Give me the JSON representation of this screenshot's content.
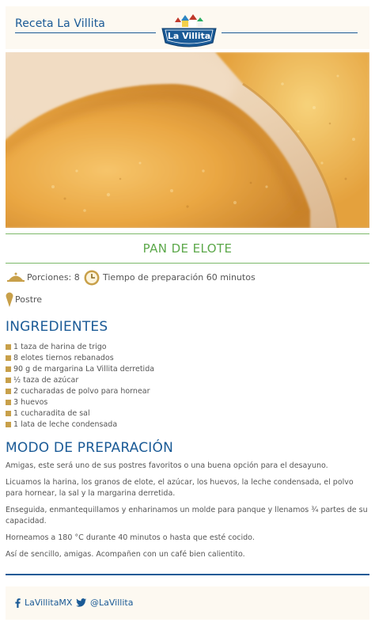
{
  "header": {
    "title": "Receta La Villita",
    "logo_text": "La Villita",
    "brand_color": "#1a5a96"
  },
  "recipe": {
    "title": "PAN DE ELOTE",
    "portions": "Porciones: 8",
    "prep_time": "Tiempo de preparación 60 minutos",
    "category": "Postre"
  },
  "ingredients": {
    "heading": "INGREDIENTES",
    "items": [
      "1 taza de harina de trigo",
      "8 elotes tiernos rebanados",
      "90 g de margarina La Villita derretida",
      "½ taza de azúcar",
      "2 cucharadas de polvo para hornear",
      "3 huevos",
      "1 cucharadita de sal",
      "1 lata de leche condensada"
    ]
  },
  "preparation": {
    "heading": "MODO DE PREPARACIÓN",
    "steps": [
      "Amigas, este será uno de sus postres favoritos o una buena opción para el desayuno.",
      "Licuamos la harina, los granos de elote, el azúcar, los huevos, la leche condensada, el polvo para hornear, la sal y la margarina derretida.",
      "Enseguida, enmantequillamos y enharinamos un molde para panque y llenamos ¾ partes de su capacidad.",
      "Horneamos a 180 °C durante 40 minutos o hasta que esté cocido.",
      "Así de sencillo, amigas. Acompañen con un café bien calientito."
    ]
  },
  "footer": {
    "facebook": "LaVillitaMX",
    "twitter": "@LaVillita"
  },
  "colors": {
    "accent_green": "#5ca84a",
    "bullet_gold": "#c8a04a",
    "cream": "#fdf9f1"
  }
}
